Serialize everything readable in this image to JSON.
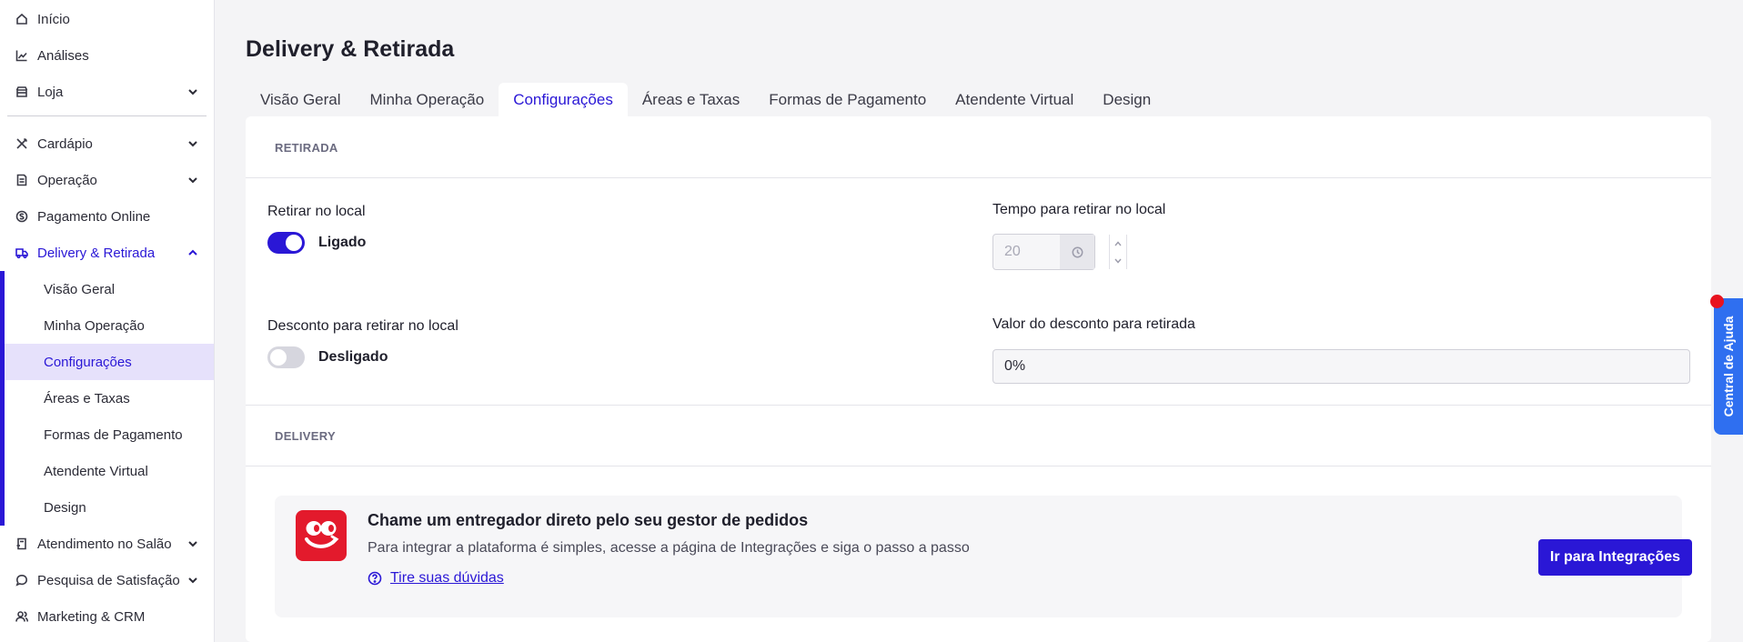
{
  "sidebar": {
    "items": [
      {
        "label": "Início",
        "icon": "home-icon"
      },
      {
        "label": "Análises",
        "icon": "chart-line-icon"
      },
      {
        "label": "Loja",
        "icon": "store-icon"
      },
      {
        "label": "Cardápio",
        "icon": "utensils-icon"
      },
      {
        "label": "Operação",
        "icon": "clipboard-icon"
      },
      {
        "label": "Pagamento Online",
        "icon": "dollar-circle-icon"
      },
      {
        "label": "Delivery & Retirada",
        "icon": "delivery-icon"
      },
      {
        "label": "Atendimento no Salão",
        "icon": "table-service-icon"
      },
      {
        "label": "Pesquisa de Satisfação",
        "icon": "chat-bubble-icon"
      },
      {
        "label": "Marketing & CRM",
        "icon": "users-icon"
      }
    ],
    "subitems": [
      {
        "label": "Visão Geral"
      },
      {
        "label": "Minha Operação"
      },
      {
        "label": "Configurações"
      },
      {
        "label": "Áreas e Taxas"
      },
      {
        "label": "Formas de Pagamento"
      },
      {
        "label": "Atendente Virtual"
      },
      {
        "label": "Design"
      }
    ]
  },
  "page": {
    "title": "Delivery & Retirada"
  },
  "tabs": [
    {
      "label": "Visão Geral"
    },
    {
      "label": "Minha Operação"
    },
    {
      "label": "Configurações"
    },
    {
      "label": "Áreas e Taxas"
    },
    {
      "label": "Formas de Pagamento"
    },
    {
      "label": "Atendente Virtual"
    },
    {
      "label": "Design"
    }
  ],
  "pickup": {
    "section_label": "RETIRADA",
    "local_label": "Retirar no local",
    "local_state": "Ligado",
    "time_label": "Tempo para retirar no local",
    "time_value": "20",
    "discount_label": "Desconto para retirar no local",
    "discount_state": "Desligado",
    "discount_value_label": "Valor do desconto para retirada",
    "discount_value": "0%"
  },
  "delivery": {
    "section_label": "DELIVERY",
    "banner_title": "Chame um entregador direto pelo seu gestor de pedidos",
    "banner_desc": "Para integrar a plataforma é simples, acesse a página de Integrações e siga o passo a passo",
    "banner_link": "Tire suas dúvidas",
    "cta_label": "Ir para Integrações"
  },
  "help": {
    "label": "Central de Ajuda"
  },
  "colors": {
    "accent": "#2a17d6",
    "brand_red": "#e31a2c",
    "help_blue": "#2f6ff0"
  }
}
